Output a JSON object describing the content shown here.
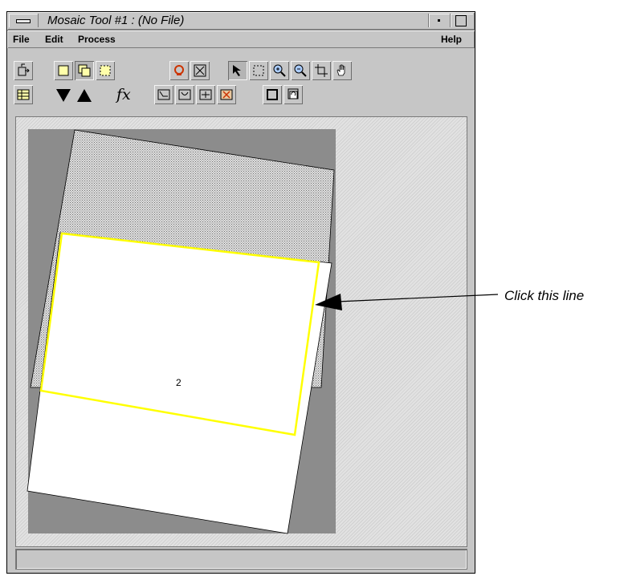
{
  "window": {
    "title": "Mosaic Tool #1 : (No File)",
    "icons": [
      "window-menu-icon",
      "minimize-icon",
      "maximize-icon"
    ]
  },
  "menubar": {
    "file": "File",
    "edit": "Edit",
    "process": "Process",
    "help": "Help"
  },
  "toolbar": {
    "fx_label": "fx",
    "row1_icons": [
      "open-image-icon",
      "select-image-icon",
      "overlap-icon",
      "dashed-select-icon",
      "image-color-icon",
      "fit-to-window-icon",
      "pointer-icon",
      "box-select-icon",
      "zoom-in-icon",
      "zoom-out-icon",
      "crop-icon",
      "pan-hand-icon"
    ],
    "row2_icons": [
      "table-icon",
      "move-down-icon",
      "move-up-icon",
      "function-icon",
      "cutline-icon",
      "cutline-edit-icon",
      "cutline-split-icon",
      "cutline-delete-icon",
      "output-icon",
      "refresh-icon"
    ],
    "accent_color": "#cc3300"
  },
  "canvas": {
    "image_label": "2",
    "selection_color": "#ffff00",
    "background_color": "#8c8c8c"
  },
  "annotation": {
    "text": "Click this line"
  }
}
